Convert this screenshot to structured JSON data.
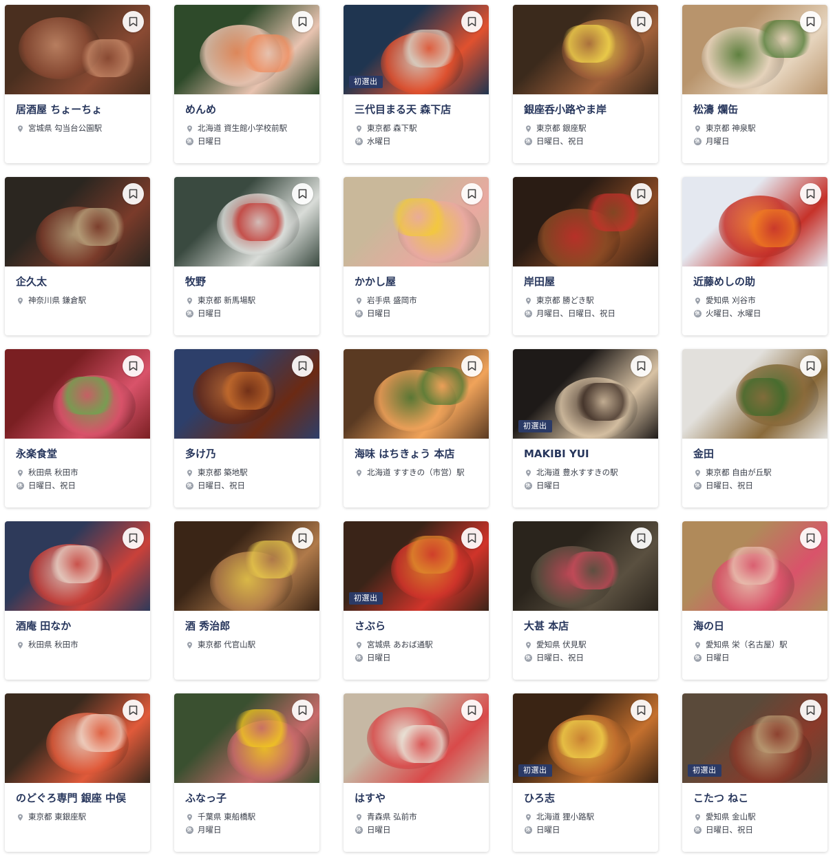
{
  "bookmark_icon": "bookmark-icon",
  "location_icon": "map-pin-icon",
  "holiday_icon": "holiday-icon",
  "holiday_icon_glyph": "休",
  "badge_color": "#2b3a66",
  "restaurants": [
    {
      "name": "居酒屋 ちょーちょ",
      "location": "宮城県 勾当台公園駅",
      "holiday": "",
      "badge": "",
      "tone": [
        "#4a2f1f",
        "#8a4a33",
        "#c98b6a"
      ]
    },
    {
      "name": "めんめ",
      "location": "北海道 資生館小学校前駅",
      "holiday": "日曜日",
      "badge": "",
      "tone": [
        "#2e4a2a",
        "#e8c3b0",
        "#f08a5a"
      ]
    },
    {
      "name": "三代目まる天 森下店",
      "location": "東京都 森下駅",
      "holiday": "水曜日",
      "badge": "初選出",
      "tone": [
        "#1f3550",
        "#e0512f",
        "#d9d1c4"
      ]
    },
    {
      "name": "銀座呑小路やま岸",
      "location": "東京都 銀座駅",
      "holiday": "日曜日、祝日",
      "badge": "",
      "tone": [
        "#3b2a1c",
        "#a0603a",
        "#f2d64b"
      ]
    },
    {
      "name": "松濤 爛缶",
      "location": "東京都 神泉駅",
      "holiday": "月曜日",
      "badge": "",
      "tone": [
        "#b8946c",
        "#e6d4bd",
        "#4d7a34"
      ]
    },
    {
      "name": "企久太",
      "location": "神奈川県 鎌倉駅",
      "holiday": "",
      "badge": "",
      "tone": [
        "#2b2620",
        "#7a3b2a",
        "#b9a27c"
      ]
    },
    {
      "name": "牧野",
      "location": "東京都 新馬場駅",
      "holiday": "日曜日",
      "badge": "",
      "tone": [
        "#3a4a40",
        "#d9dcd8",
        "#c43a35"
      ]
    },
    {
      "name": "かかし屋",
      "location": "岩手県 盛岡市",
      "holiday": "日曜日",
      "badge": "",
      "tone": [
        "#c9b89a",
        "#e9a9a0",
        "#f3c93a"
      ]
    },
    {
      "name": "岸田屋",
      "location": "東京都 勝どき駅",
      "holiday": "月曜日、日曜日、祝日",
      "badge": "",
      "tone": [
        "#2a1c14",
        "#8b4a24",
        "#c7302a"
      ]
    },
    {
      "name": "近藤めしの助",
      "location": "愛知県 刈谷市",
      "holiday": "火曜日、水曜日",
      "badge": "",
      "tone": [
        "#e4e8f0",
        "#c6322a",
        "#f07a1f"
      ]
    },
    {
      "name": "永楽食堂",
      "location": "秋田県 秋田市",
      "holiday": "日曜日、祝日",
      "badge": "",
      "tone": [
        "#7a1f22",
        "#d9536a",
        "#6aa84f"
      ]
    },
    {
      "name": "多け乃",
      "location": "東京都 築地駅",
      "holiday": "日曜日、祝日",
      "badge": "",
      "tone": [
        "#2d3f6a",
        "#6b2a14",
        "#c46a2a"
      ]
    },
    {
      "name": "海味 はちきょう 本店",
      "location": "北海道 すすきの（市営）駅",
      "holiday": "",
      "badge": "",
      "tone": [
        "#5a3a22",
        "#f0a35a",
        "#4f7a34"
      ]
    },
    {
      "name": "MAKIBI YUI",
      "location": "北海道 豊水すすきの駅",
      "holiday": "日曜日",
      "badge": "初選出",
      "tone": [
        "#1e1a18",
        "#d8c2a4",
        "#3a2a22"
      ]
    },
    {
      "name": "金田",
      "location": "東京都 自由が丘駅",
      "holiday": "日曜日、祝日",
      "badge": "",
      "tone": [
        "#e2e0dc",
        "#8a6a3a",
        "#3e6a2a"
      ]
    },
    {
      "name": "酒庵 田なか",
      "location": "秋田県 秋田市",
      "holiday": "",
      "badge": "",
      "tone": [
        "#2e3a5a",
        "#c9413a",
        "#e8d0c4"
      ]
    },
    {
      "name": "酒 秀治郎",
      "location": "東京都 代官山駅",
      "holiday": "",
      "badge": "",
      "tone": [
        "#3a2516",
        "#b07a4a",
        "#e8c84a"
      ]
    },
    {
      "name": "さぶら",
      "location": "宮城県 あおば通駅",
      "holiday": "日曜日",
      "badge": "初選出",
      "tone": [
        "#3a2418",
        "#d0342a",
        "#e08a2a"
      ]
    },
    {
      "name": "大甚 本店",
      "location": "愛知県 伏見駅",
      "holiday": "日曜日、祝日",
      "badge": "",
      "tone": [
        "#2a241c",
        "#5a5040",
        "#c94a5a"
      ]
    },
    {
      "name": "海の日",
      "location": "愛知県 栄（名古屋）駅",
      "holiday": "日曜日",
      "badge": "",
      "tone": [
        "#b08a5a",
        "#d9536a",
        "#e9c0b0"
      ]
    },
    {
      "name": "のどぐろ専門 銀座 中俣",
      "location": "東京都 東銀座駅",
      "holiday": "",
      "badge": "",
      "tone": [
        "#3a2a1e",
        "#e05a3a",
        "#f0d0c0"
      ]
    },
    {
      "name": "ふなっ子",
      "location": "千葉県 東船橋駅",
      "holiday": "月曜日",
      "badge": "",
      "tone": [
        "#3a5030",
        "#c86a6a",
        "#f2c81f"
      ]
    },
    {
      "name": "はすや",
      "location": "青森県 弘前市",
      "holiday": "日曜日",
      "badge": "",
      "tone": [
        "#c6b8a4",
        "#d94a4a",
        "#e9e2d6"
      ]
    },
    {
      "name": "ひろ志",
      "location": "北海道 狸小路駅",
      "holiday": "日曜日",
      "badge": "初選出",
      "tone": [
        "#3a2414",
        "#c4702e",
        "#f2d24a"
      ]
    },
    {
      "name": "こたつ ねこ",
      "location": "愛知県 金山駅",
      "holiday": "日曜日、祝日",
      "badge": "初選出",
      "tone": [
        "#5a4a3a",
        "#8a3a2a",
        "#b99a72"
      ]
    }
  ]
}
